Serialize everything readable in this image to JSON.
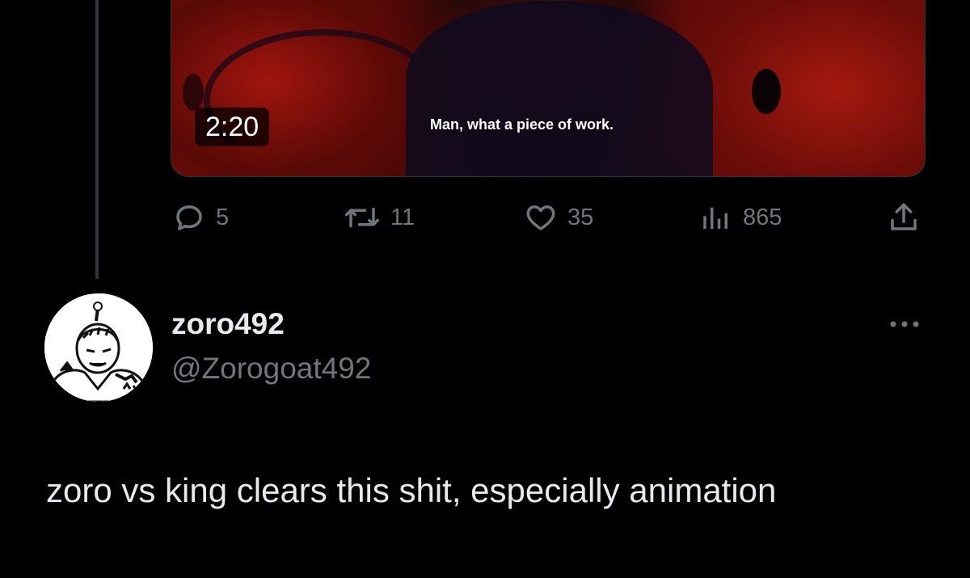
{
  "parent_tweet": {
    "video": {
      "duration": "2:20",
      "subtitle": "Man, what a piece of work."
    },
    "actions": {
      "replies": "5",
      "reposts": "11",
      "likes": "35",
      "views": "865"
    }
  },
  "reply_tweet": {
    "display_name": "zoro492",
    "handle": "@Zorogoat492",
    "text": "zoro vs king clears this shit, especially animation"
  },
  "icons": {
    "reply": "reply-icon",
    "repost": "repost-icon",
    "like": "heart-icon",
    "views": "views-icon",
    "share": "share-icon",
    "more": "more-icon"
  },
  "colors": {
    "background": "#000000",
    "text_primary": "#e7e9ea",
    "text_secondary": "#71767b",
    "thread_line": "#333639"
  }
}
